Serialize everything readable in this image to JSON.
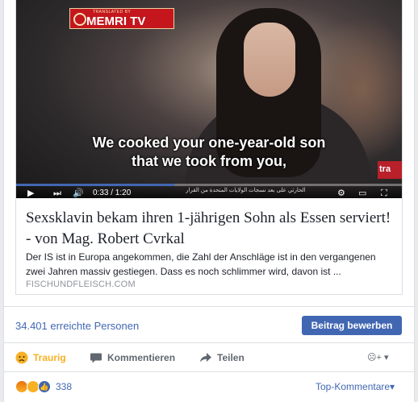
{
  "video": {
    "logo_brand": "MEMRI TV",
    "logo_translated": "TRANSLATED BY",
    "subtitle_line1": "We cooked your one-year-old son",
    "subtitle_line2": "that we took from you,",
    "time": "0:33 / 1:20",
    "progress": 0.41,
    "badge": "tra",
    "ticker_text": "الحارثي على بعد نسجات الولايات المتحدة من القرار"
  },
  "article": {
    "title": "Sexsklavin bekam ihren 1-jährigen Sohn als Essen serviert! - von Mag. Robert Cvrkal",
    "description": "Der IS ist in Europa angekommen, die Zahl der Anschläge ist in den vergangenen zwei Jahren massiv gestiegen. Dass es noch schlimmer wird, davon ist ...",
    "domain": "FISCHUNDFLEISCH.COM"
  },
  "stats": {
    "reach": "34.401 erreichte Personen",
    "boost_label": "Beitrag bewerben"
  },
  "actions": {
    "reaction_label": "Traurig",
    "comment_label": "Kommentieren",
    "share_label": "Teilen"
  },
  "reactions": {
    "count": "338",
    "sort_label": "Top-Kommentare"
  },
  "colors": {
    "accent": "#4267b2",
    "sad": "#f7b125",
    "logo_red": "#c4161c"
  }
}
